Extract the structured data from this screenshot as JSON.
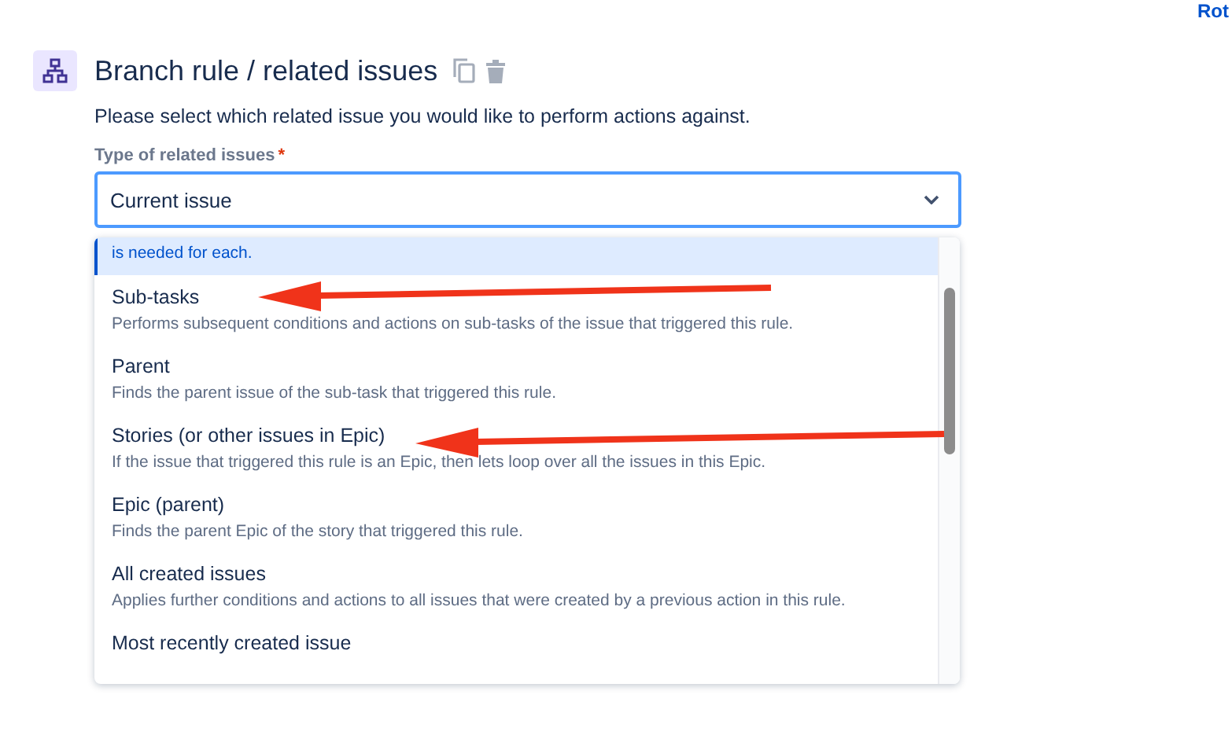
{
  "top_link": "Rot",
  "header": {
    "title": "Branch rule / related issues",
    "description": "Please select which related issue you would like to perform actions against."
  },
  "field": {
    "label": "Type of related issues",
    "required_mark": "*",
    "value": "Current issue"
  },
  "options": [
    {
      "description": "is needed for each.",
      "selected": true
    },
    {
      "title": "Sub-tasks",
      "description": "Performs subsequent conditions and actions on sub-tasks of the issue that triggered this rule.",
      "selected": false
    },
    {
      "title": "Parent",
      "description": "Finds the parent issue of the sub-task that triggered this rule.",
      "selected": false
    },
    {
      "title": "Stories (or other issues in Epic)",
      "description": "If the issue that triggered this rule is an Epic, then lets loop over all the issues in this Epic.",
      "selected": false
    },
    {
      "title": "Epic (parent)",
      "description": "Finds the parent Epic of the story that triggered this rule.",
      "selected": false
    },
    {
      "title": "All created issues",
      "description": "Applies further conditions and actions to all issues that were created by a previous action in this rule.",
      "selected": false
    },
    {
      "title": "Most recently created issue",
      "selected": false
    }
  ]
}
